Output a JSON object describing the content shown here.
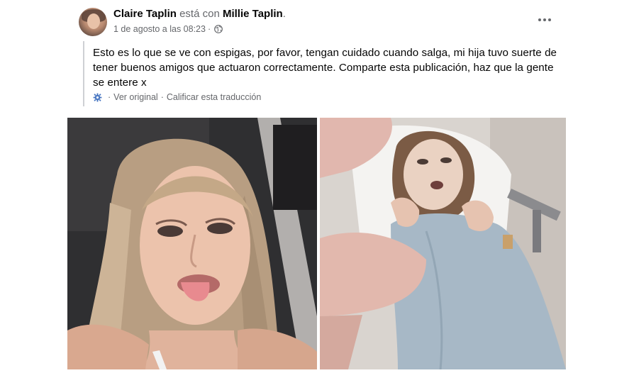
{
  "post": {
    "author": "Claire Taplin",
    "connector": " está con ",
    "tagged": "Millie Taplin",
    "trailing": ".",
    "timestamp": "1 de agosto a las 08:23",
    "meta_separator": "·",
    "privacy_icon": "globe-icon",
    "more_icon": "more-options-icon",
    "text": "Esto es lo que se ve con espigas, por favor, tengan cuidado cuando salga, mi hija tuvo suerte de tener buenos amigos que actuaron correctamente. Comparte esta publicación, haz que la gente se entere x",
    "translation": {
      "icon": "translate-gear-icon",
      "see_original": "Ver original",
      "separator": "·",
      "rate": "Calificar esta traducción"
    }
  },
  "colors": {
    "primary_text": "#050505",
    "secondary_text": "#65676b",
    "quote_bar": "#ced0d4",
    "background": "#ffffff"
  },
  "photos": [
    {
      "subject": "selfie-photo"
    },
    {
      "subject": "hospital-photo"
    }
  ]
}
